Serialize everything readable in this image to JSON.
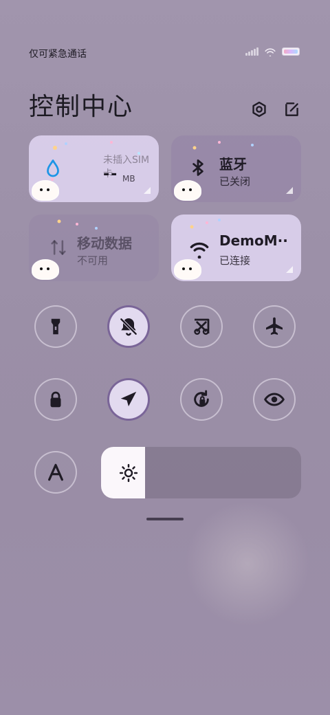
{
  "status_bar": {
    "carrier": "仅可紧急通话",
    "icons": [
      "signal-icon",
      "wifi-icon",
      "battery-icon"
    ]
  },
  "header": {
    "title": "控制中心",
    "actions": [
      "settings-icon",
      "edit-icon"
    ]
  },
  "tiles": {
    "sim": {
      "title": "未插入SIM卡",
      "value": "--",
      "unit": "MB",
      "icon": "water-drop-icon"
    },
    "bluetooth": {
      "title": "蓝牙",
      "status": "已关闭",
      "icon": "bluetooth-icon"
    },
    "mobile_data": {
      "title": "移动数据",
      "status": "不可用",
      "icon": "mobile-data-icon"
    },
    "wifi": {
      "title": "DemoM··",
      "status": "已连接",
      "icon": "wifi-icon"
    }
  },
  "toggles": [
    {
      "name": "flashlight-toggle",
      "icon": "flashlight-icon",
      "active": false
    },
    {
      "name": "silent-toggle",
      "icon": "bell-off-icon",
      "active": true
    },
    {
      "name": "screenshot-toggle",
      "icon": "scissors-icon",
      "active": false
    },
    {
      "name": "airplane-toggle",
      "icon": "airplane-icon",
      "active": false
    },
    {
      "name": "lock-screen-toggle",
      "icon": "lock-icon",
      "active": false
    },
    {
      "name": "location-toggle",
      "icon": "location-arrow-icon",
      "active": true
    },
    {
      "name": "rotation-lock-toggle",
      "icon": "rotate-lock-icon",
      "active": false
    },
    {
      "name": "eye-comfort-toggle",
      "icon": "eye-icon",
      "active": false
    },
    {
      "name": "auto-brightness-toggle",
      "icon": "auto-a-icon",
      "active": false
    }
  ],
  "brightness": {
    "level": 0.22,
    "icon": "sun-icon"
  }
}
